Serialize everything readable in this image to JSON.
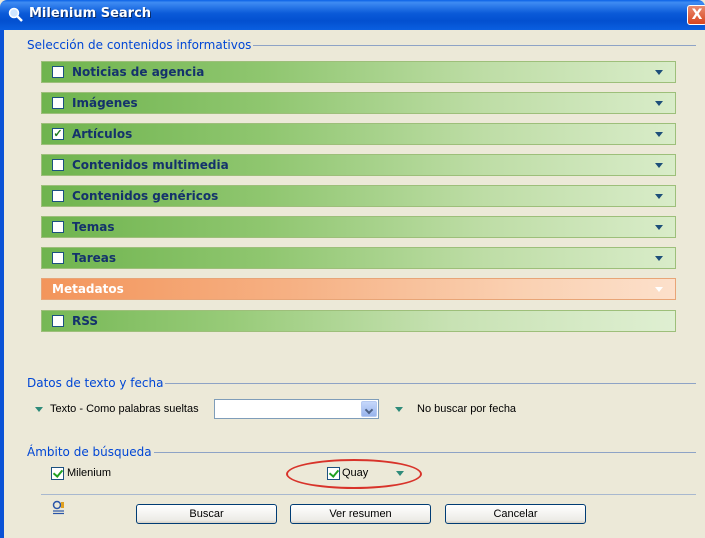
{
  "window": {
    "title": "Milenium Search",
    "close_glyph": "X"
  },
  "contents_group": {
    "title": "Selección de contenidos informativos",
    "items": [
      {
        "label": "Noticias de agencia",
        "checked": false,
        "color": "#8fc66f"
      },
      {
        "label": "Imágenes",
        "checked": false,
        "color": "#8fc66f"
      },
      {
        "label": "Artículos",
        "checked": true,
        "color": "#8fc66f"
      },
      {
        "label": "Contenidos multimedia",
        "checked": false,
        "color": "#8fc66f"
      },
      {
        "label": "Contenidos genéricos",
        "checked": false,
        "color": "#8fc66f"
      },
      {
        "label": "Temas",
        "checked": false,
        "color": "#8fc66f"
      },
      {
        "label": "Tareas",
        "checked": false,
        "color": "#8fc66f"
      },
      {
        "label": "Metadatos",
        "color": "#f6b184"
      },
      {
        "label": "RSS",
        "checked": false,
        "color": "#8fc66f"
      }
    ]
  },
  "text_date_group": {
    "title": "Datos de texto y fecha",
    "text_mode_label": "Texto - Como palabras sueltas",
    "text_value": "",
    "date_label": "No buscar por fecha"
  },
  "scope_group": {
    "title": "Ámbito de búsqueda",
    "milenium_label": "Milenium",
    "milenium_checked": true,
    "quay_label": "Quay",
    "quay_checked": true
  },
  "footer": {
    "search_label": "Buscar",
    "summary_label": "Ver resumen",
    "cancel_label": "Cancelar"
  },
  "icons": {
    "title": "search-magnifier-icon",
    "tool": "search-settings-icon"
  }
}
